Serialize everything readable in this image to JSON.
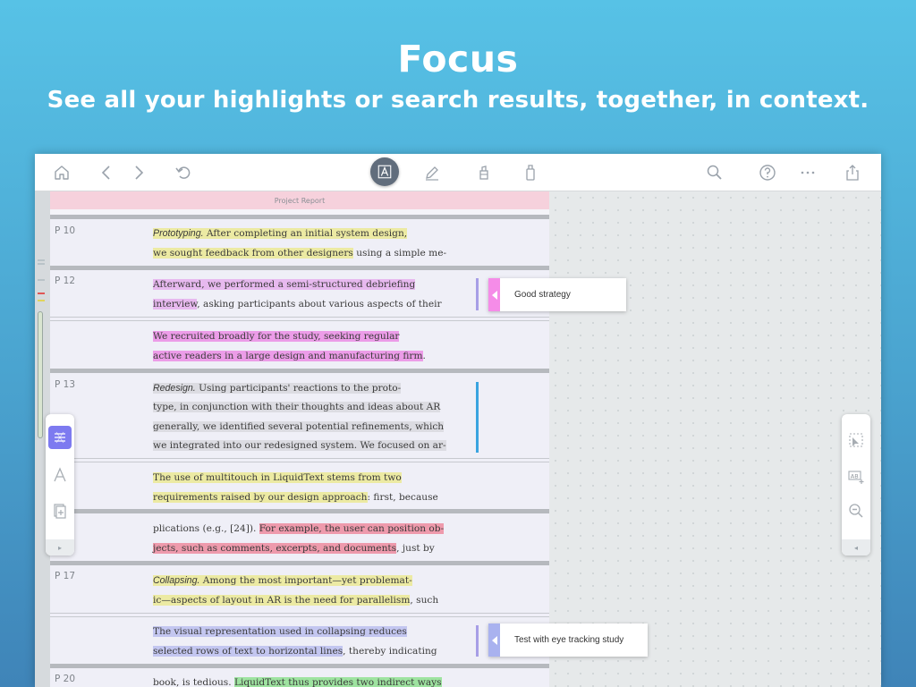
{
  "hero": {
    "title": "Focus",
    "subtitle": "See all your highlights or search results, together, in context."
  },
  "toolbar": {
    "left_icons": [
      "home-icon",
      "back-arrow-icon",
      "forward-arrow-icon",
      "undo-icon"
    ],
    "center_icons": [
      "text-select-icon",
      "pen-icon",
      "highlighter-icon",
      "eraser-icon"
    ],
    "right_icons": [
      "search-icon",
      "help-icon",
      "more-icon",
      "share-icon"
    ],
    "active_tool": "text-select-icon"
  },
  "document": {
    "header_title": "Project Report",
    "pages": [
      "P 10",
      "P 12",
      "P 13",
      "P 17",
      "P 20"
    ],
    "excerpts": [
      {
        "line1": [
          {
            "t": "Prototyping.",
            "c": "y",
            "i": true
          },
          {
            "t": " After completing an initial system design,",
            "c": "y"
          }
        ],
        "line2": [
          {
            "t": "we sought feedback from other designers",
            "c": "y"
          },
          {
            "t": " using a simple me-",
            "c": ""
          }
        ]
      },
      {
        "line1": [
          {
            "t": "Afterward, we performed a semi-structured debriefing",
            "c": "pl"
          }
        ],
        "line2": [
          {
            "t": "interview",
            "c": "pl"
          },
          {
            "t": ", asking participants about various aspects of their",
            "c": ""
          }
        ]
      },
      {
        "line1": [
          {
            "t": "We recruited broadly for the study, seeking regular",
            "c": "p"
          }
        ],
        "line2": [
          {
            "t": "active readers in a large design and manufacturing firm",
            "c": "p"
          },
          {
            "t": ".",
            "c": ""
          }
        ]
      },
      {
        "line1": [
          {
            "t": "Redesign.",
            "c": "g",
            "i": true
          },
          {
            "t": " Using participants' reactions to the proto-",
            "c": "g"
          }
        ],
        "line2": [
          {
            "t": "type, in conjunction with their thoughts and ideas about AR",
            "c": "g"
          }
        ],
        "line3": [
          {
            "t": "generally, we identified several potential refinements, which",
            "c": "g"
          }
        ],
        "line4": [
          {
            "t": "we integrated into our redesigned system. We focused on ar-",
            "c": "g"
          }
        ]
      },
      {
        "line1": [
          {
            "t": "The use of multitouch in LiquidText stems from two",
            "c": "y"
          }
        ],
        "line2": [
          {
            "t": "requirements raised by our design approach",
            "c": "y"
          },
          {
            "t": ": first, because",
            "c": ""
          }
        ]
      },
      {
        "line1": [
          {
            "t": "plications (e.g., [24]). ",
            "c": ""
          },
          {
            "t": "For example, the user can position ob-",
            "c": "r"
          }
        ],
        "line2": [
          {
            "t": "jects, such as comments, excerpts, and documents",
            "c": "r"
          },
          {
            "t": ", just by",
            "c": ""
          }
        ]
      },
      {
        "line1": [
          {
            "t": "Collapsing.",
            "c": "y",
            "i": true
          },
          {
            "t": " Among the most important—yet problemat-",
            "c": "y"
          }
        ],
        "line2": [
          {
            "t": "ic—aspects of layout in AR is the need for parallelism",
            "c": "y"
          },
          {
            "t": ", such",
            "c": ""
          }
        ]
      },
      {
        "line1": [
          {
            "t": "The visual representation used in collapsing reduces",
            "c": "b"
          }
        ],
        "line2": [
          {
            "t": "selected rows of text to horizontal lines",
            "c": "b"
          },
          {
            "t": ", thereby indicating",
            "c": ""
          }
        ]
      },
      {
        "line1": [
          {
            "t": "book, is tedious. ",
            "c": ""
          },
          {
            "t": "LiquidText thus provides two indirect ways",
            "c": "gr"
          }
        ]
      }
    ]
  },
  "notes": [
    {
      "text": "Good strategy",
      "color": "#f58ce8"
    },
    {
      "text": "Test with eye tracking study",
      "color": "#a9b2ef"
    }
  ],
  "left_panel": {
    "icons": [
      "excerpt-list-icon",
      "text-style-icon",
      "add-page-icon"
    ],
    "collapse": "▸"
  },
  "right_panel": {
    "icons": [
      "selection-pointer-icon",
      "ab-add-icon",
      "zoom-out-icon"
    ],
    "collapse": "◂"
  },
  "colors": {
    "accent_panel_button": "#7d7af0",
    "marker_blue": "#3aa4e0",
    "marker_purple": "#a79ee6"
  }
}
